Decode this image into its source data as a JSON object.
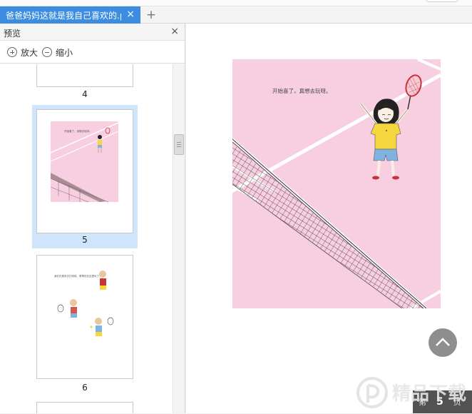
{
  "tabs": {
    "active_title": "爸爸妈妈这就是我自己喜欢的.pdf",
    "close_glyph": "×",
    "new_tab_glyph": "+"
  },
  "sidebar": {
    "title": "预览",
    "close_glyph": "×",
    "zoom_in_label": "放大",
    "zoom_out_label": "缩小",
    "thumbnails": [
      {
        "page": "4",
        "selected": false
      },
      {
        "page": "5",
        "selected": true
      },
      {
        "page": "6",
        "selected": false
      }
    ]
  },
  "page_content": {
    "caption": "开始喜了，真想去玩呀。",
    "thumb_caption_p5": "开始喜了，真想去玩呀。",
    "thumb_caption_p6": "我们在周末去打网球，哥哥也在这里玩了。"
  },
  "page_indicator": {
    "label": "第",
    "value": "5",
    "suffix": "页"
  },
  "watermark": {
    "text": "精品下载"
  },
  "colors": {
    "tab_active": "#3c8de0",
    "selected_thumb": "#cfe5fb",
    "page_background": "#f7cfe0",
    "net": "#4a3a3a",
    "shirt": "#f5d63f",
    "shorts": "#7fb3e0",
    "racket": "#c8323c"
  },
  "icons": [
    "zoom-in-icon",
    "zoom-out-icon",
    "close-icon",
    "back-to-top-icon"
  ]
}
